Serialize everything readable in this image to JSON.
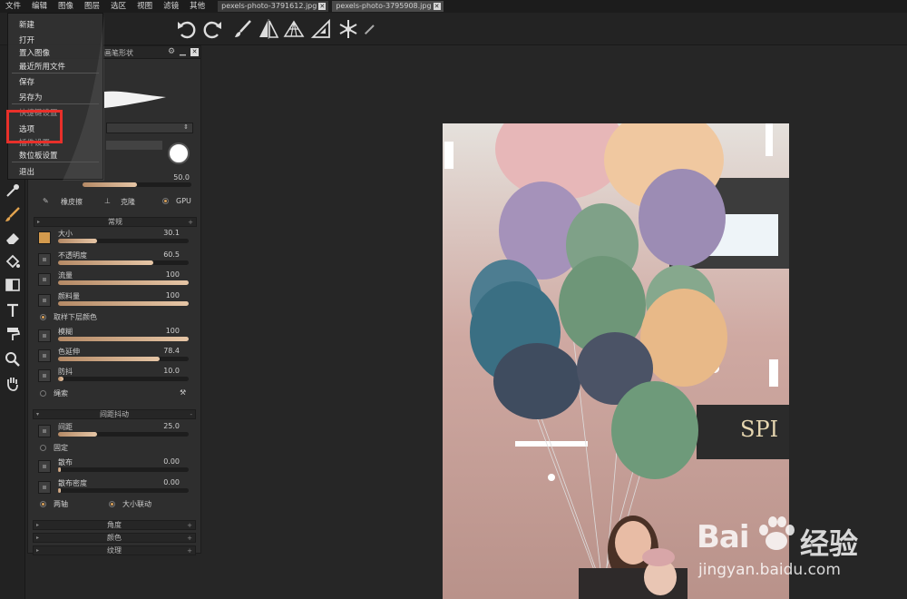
{
  "menubar": {
    "items": [
      "文件",
      "编辑",
      "图像",
      "图层",
      "选区",
      "视图",
      "滤镜",
      "其他"
    ],
    "tabs": [
      {
        "label": "pexels-photo-3791612.jpg",
        "close": "✕"
      },
      {
        "label": "pexels-photo-3795908.jpg",
        "close": "✕"
      }
    ]
  },
  "file_menu": {
    "items": [
      "新建",
      "打开",
      "置入图像",
      "最近所用文件",
      "保存",
      "另存为",
      "快捷键设置",
      "选项",
      "插件设置",
      "数位板设置",
      "退出"
    ]
  },
  "panel": {
    "header": "画笔形状",
    "opacity_value": "50.0",
    "tools": {
      "eraser": "橡皮擦",
      "clone": "克隆",
      "gpu": "GPU"
    },
    "section_general": "常规",
    "params": [
      {
        "label": "大小",
        "value": "30.1",
        "fraction": 0.3
      },
      {
        "label": "不透明度",
        "value": "60.5",
        "fraction": 0.73
      },
      {
        "label": "流量",
        "value": "100",
        "fraction": 1.0
      },
      {
        "label": "颜料量",
        "value": "100",
        "fraction": 1.0
      }
    ],
    "sample_below": "取样下层颜色",
    "params2": [
      {
        "label": "模糊",
        "value": "100",
        "fraction": 1.0
      },
      {
        "label": "色延伸",
        "value": "78.4",
        "fraction": 0.78
      },
      {
        "label": "防抖",
        "value": "10.0",
        "fraction": 0.04
      }
    ],
    "rope": "绳索",
    "section_jitter": "间距抖动",
    "params3": [
      {
        "label": "间距",
        "value": "25.0",
        "fraction": 0.3
      }
    ],
    "fixed": "固定",
    "params4": [
      {
        "label": "散布",
        "value": "0.00",
        "fraction": 0.0
      },
      {
        "label": "散布密度",
        "value": "0.00",
        "fraction": 0.0
      }
    ],
    "both_axes": "两轴",
    "size_link": "大小联动",
    "sections_bottom": [
      "角度",
      "颜色",
      "纹理"
    ]
  },
  "watermark": {
    "brand": "Bai",
    "brand_cn": "经验",
    "url": "jingyan.baidu.com"
  },
  "colors": {
    "accent": "#d39a4d",
    "highlight_box": "#e8302a",
    "slider_fill": "#e6c6a6"
  }
}
